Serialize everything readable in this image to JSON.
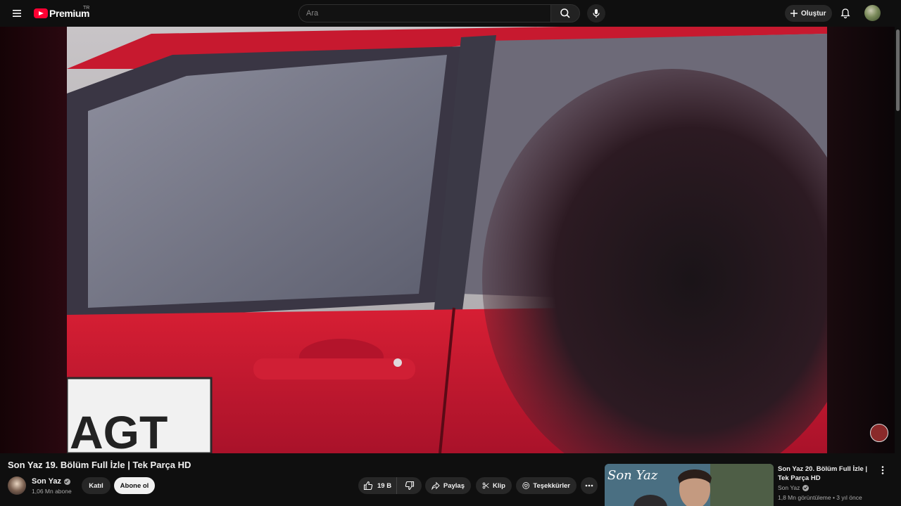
{
  "header": {
    "logo_text": "Premium",
    "country_code": "TR",
    "search_placeholder": "Ara",
    "create_label": "Oluştur",
    "icons": [
      "menu-icon",
      "search-icon",
      "mic-icon",
      "plus-icon",
      "bell-icon"
    ]
  },
  "player": {
    "frame_text": "AGT"
  },
  "video": {
    "title": "Son Yaz 19. Bölüm Full İzle | Tek Parça HD",
    "channel_name": "Son Yaz",
    "subscribers": "1,06 Mn abone",
    "join_label": "Katıl",
    "subscribe_label": "Abone ol",
    "like_count": "19 B",
    "share_label": "Paylaş",
    "clip_label": "Klip",
    "thanks_label": "Teşekkürler"
  },
  "recommended": {
    "thumb_text": "Son Yaz",
    "title": "Son Yaz 20. Bölüm Full İzle | Tek Parça HD",
    "channel": "Son Yaz",
    "meta": "1,8 Mn görüntüleme • 3 yıl önce"
  },
  "colors": {
    "background": "#0f0f0f",
    "logo_red": "#ff0033",
    "pill_bg": "#272727",
    "subscribe_bg": "#f1f1f1"
  }
}
